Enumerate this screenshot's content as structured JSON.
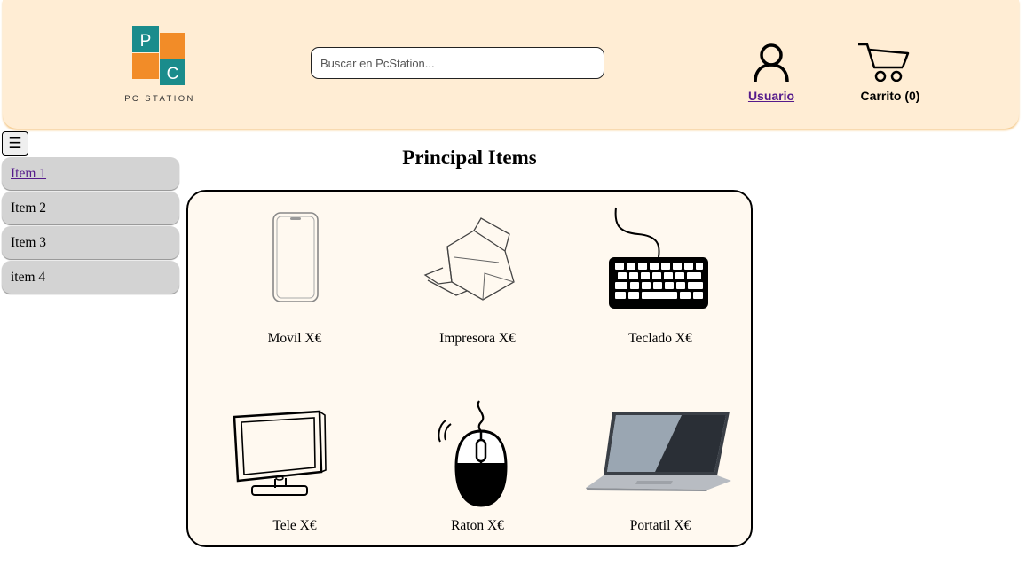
{
  "header": {
    "logo_text": "PC STATION",
    "logo_letters": [
      "P",
      "C"
    ],
    "search_placeholder": "Buscar en PcStation...",
    "user_label": "Usuario",
    "cart_label": "Carrito (0)"
  },
  "sidebar": {
    "toggle_glyph": "☰",
    "items": [
      {
        "label": "Item 1"
      },
      {
        "label": "Item 2"
      },
      {
        "label": "Item 3"
      },
      {
        "label": "item 4"
      }
    ]
  },
  "main": {
    "title": "Principal Items",
    "products": [
      {
        "label": "Movil X€",
        "icon": "phone-icon"
      },
      {
        "label": "Impresora X€",
        "icon": "printer-icon"
      },
      {
        "label": "Teclado X€",
        "icon": "keyboard-icon"
      },
      {
        "label": "Tele X€",
        "icon": "tv-icon"
      },
      {
        "label": "Raton X€",
        "icon": "mouse-icon"
      },
      {
        "label": "Portatil X€",
        "icon": "laptop-icon"
      }
    ]
  },
  "colors": {
    "header_bg": "#ffedd4",
    "logo_teal": "#1a8c8c",
    "logo_orange": "#f28c28",
    "panel_bg": "#fff9f0",
    "sidebar_bg": "#d3d3d3",
    "link": "#551a8b"
  }
}
